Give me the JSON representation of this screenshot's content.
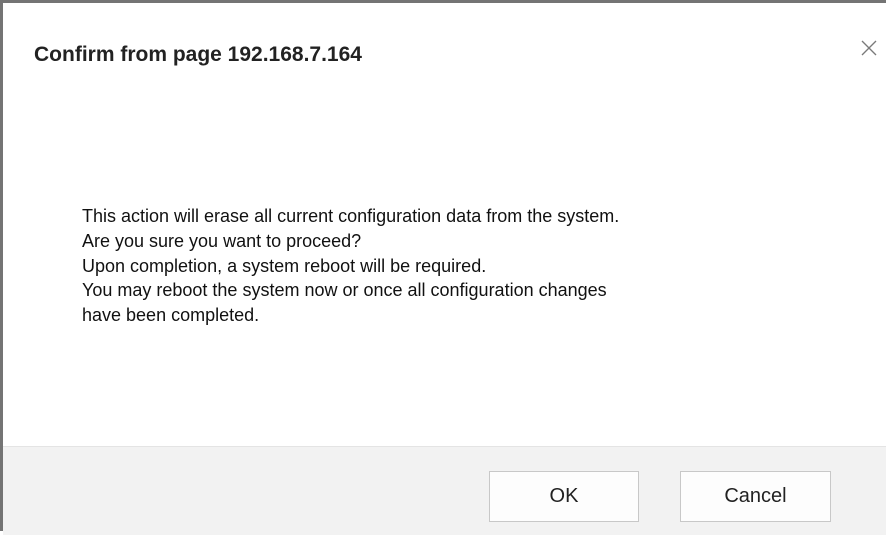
{
  "dialog": {
    "title": "Confirm from page 192.168.7.164",
    "close_icon": "close-icon",
    "message_lines": [
      "This action will erase all current configuration data from the system.",
      "Are you sure you want to proceed?",
      "Upon completion, a system reboot will be required.",
      "You may reboot the system now or once all configuration changes",
      "have been completed."
    ],
    "ok_label": "OK",
    "cancel_label": "Cancel"
  },
  "colors": {
    "border": "#747474",
    "footer_background": "#f2f2f2",
    "button_border": "#c8c8c8"
  }
}
